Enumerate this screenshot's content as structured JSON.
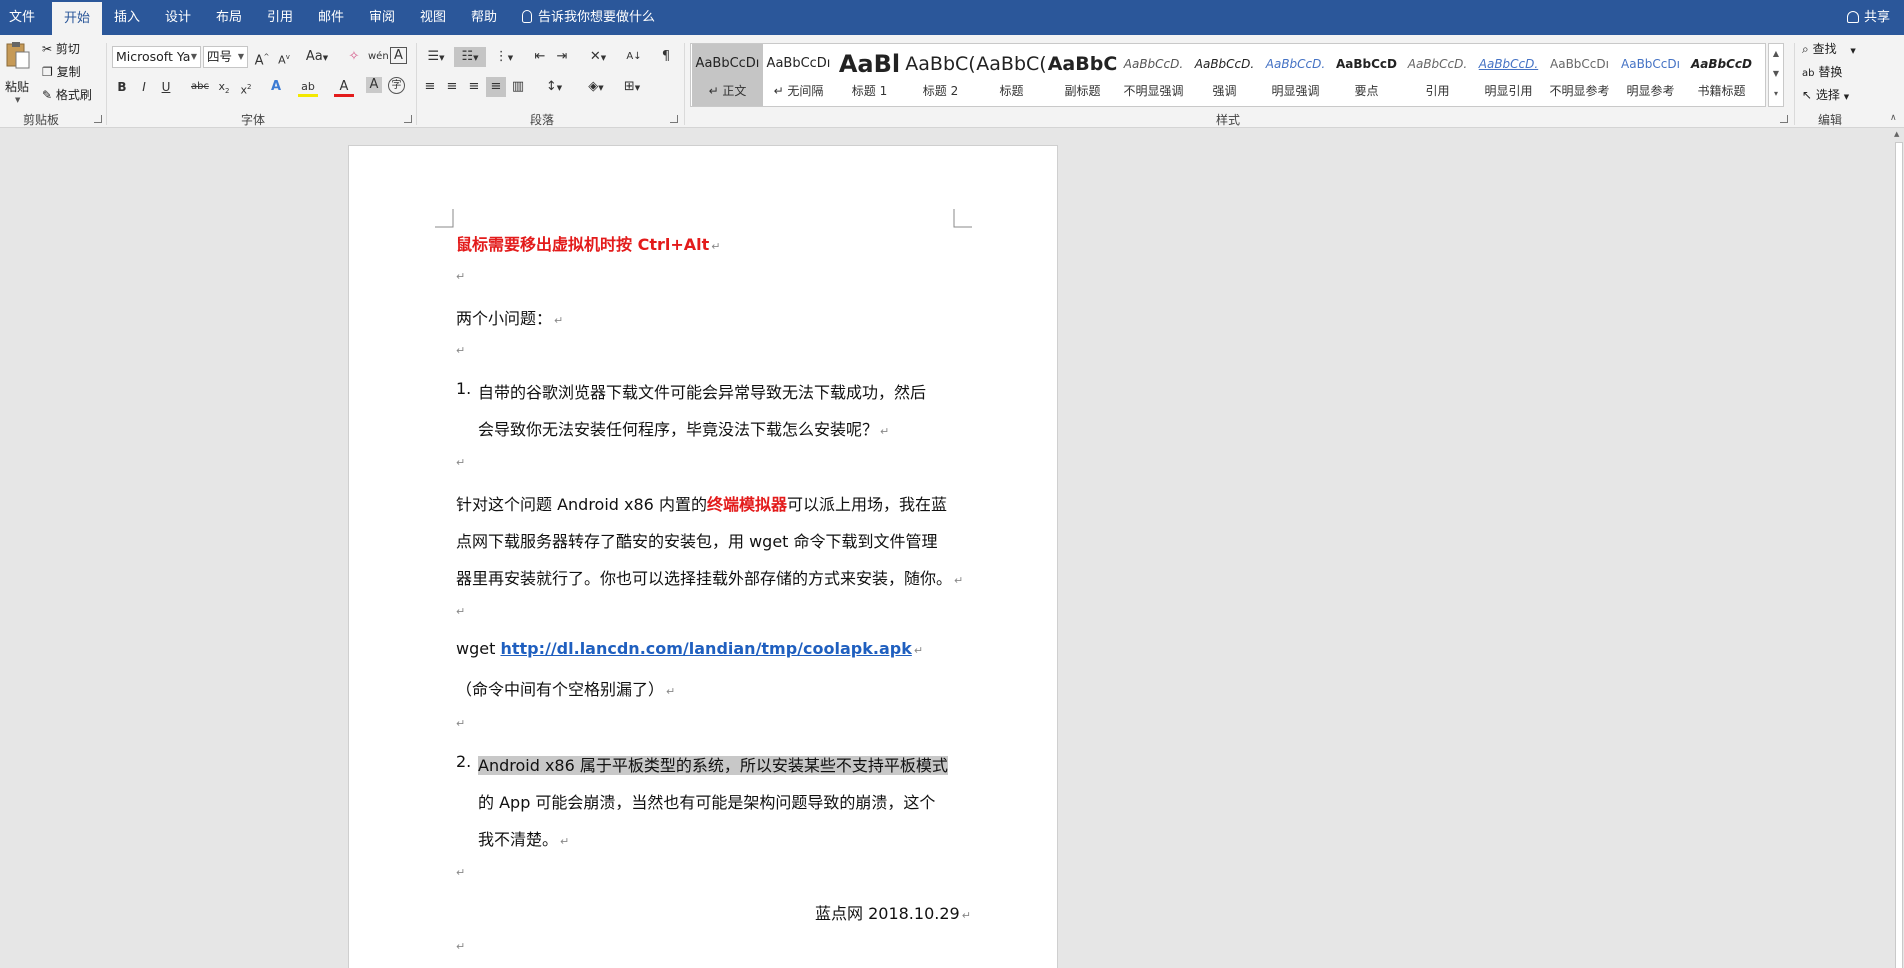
{
  "tabs": [
    "文件",
    "开始",
    "插入",
    "设计",
    "布局",
    "引用",
    "邮件",
    "审阅",
    "视图",
    "帮助"
  ],
  "active_tab": "开始",
  "tell_me": "告诉我你想要做什么",
  "share": "共享",
  "clipboard": {
    "paste": "粘贴",
    "cut": "剪切",
    "copy": "复制",
    "format_painter": "格式刷",
    "label": "剪贴板"
  },
  "font": {
    "family": "Microsoft Ya",
    "size": "四号",
    "label": "字体"
  },
  "paragraph": {
    "label": "段落"
  },
  "styles": {
    "label": "样式",
    "items": [
      {
        "sample": "AaBbCcDı",
        "name": "↵ 正文"
      },
      {
        "sample": "AaBbCcDı",
        "name": "↵ 无间隔"
      },
      {
        "sample": "AaBl",
        "name": "标题 1"
      },
      {
        "sample": "AaBbC(",
        "name": "标题 2"
      },
      {
        "sample": "AaBbC(",
        "name": "标题"
      },
      {
        "sample": "AaBbC",
        "name": "副标题"
      },
      {
        "sample": "AaBbCcD.",
        "name": "不明显强调"
      },
      {
        "sample": "AaBbCcD.",
        "name": "强调"
      },
      {
        "sample": "AaBbCcD.",
        "name": "明显强调"
      },
      {
        "sample": "AaBbCcD",
        "name": "要点"
      },
      {
        "sample": "AaBbCcD.",
        "name": "引用"
      },
      {
        "sample": "AaBbCcD.",
        "name": "明显引用"
      },
      {
        "sample": "AaBbCcDı",
        "name": "不明显参考"
      },
      {
        "sample": "AaBbCcDı",
        "name": "明显参考"
      },
      {
        "sample": "AaBbCcD",
        "name": "书籍标题"
      }
    ]
  },
  "editing": {
    "find": "查找",
    "replace": "替换",
    "select": "选择",
    "label": "编辑"
  },
  "document": {
    "line1": "鼠标需要移出虚拟机时按 Ctrl+Alt",
    "line2": "两个小问题：",
    "item1_num": "1.",
    "item1_a": "自带的谷歌浏览器下载文件可能会异常导致无法下载成功，然后",
    "item1_b": "会导致你无法安装任何程序，毕竟没法下载怎么安装呢？",
    "para_a_pre": "针对这个问题 Android x86 内置的",
    "para_a_red": "终端模拟器",
    "para_a_post": "可以派上用场，我在蓝",
    "para_b": "点网下载服务器转存了酷安的安装包，用 wget 命令下载到文件管理",
    "para_c": "器里再安装就行了。你也可以选择挂载外部存储的方式来安装，随你。",
    "wget_pre": "wget ",
    "wget_link": "http://dl.lancdn.com/landian/tmp/coolapk.apk",
    "note": "（命令中间有个空格别漏了）",
    "item2_num": "2.",
    "item2_a": "Android x86 属于平板类型的系统，所以安装某些不支持平板模式",
    "item2_b": "的 App 可能会崩溃，当然也有可能是架构问题导致的崩溃，这个",
    "item2_c": "我不清楚。",
    "signature": "蓝点网  2018.10.29",
    "para_mark": "↵"
  },
  "colors": {
    "ribbon_blue": "#2b579a",
    "accent_red": "#e31b1b",
    "link_blue": "#1f5fbf"
  }
}
